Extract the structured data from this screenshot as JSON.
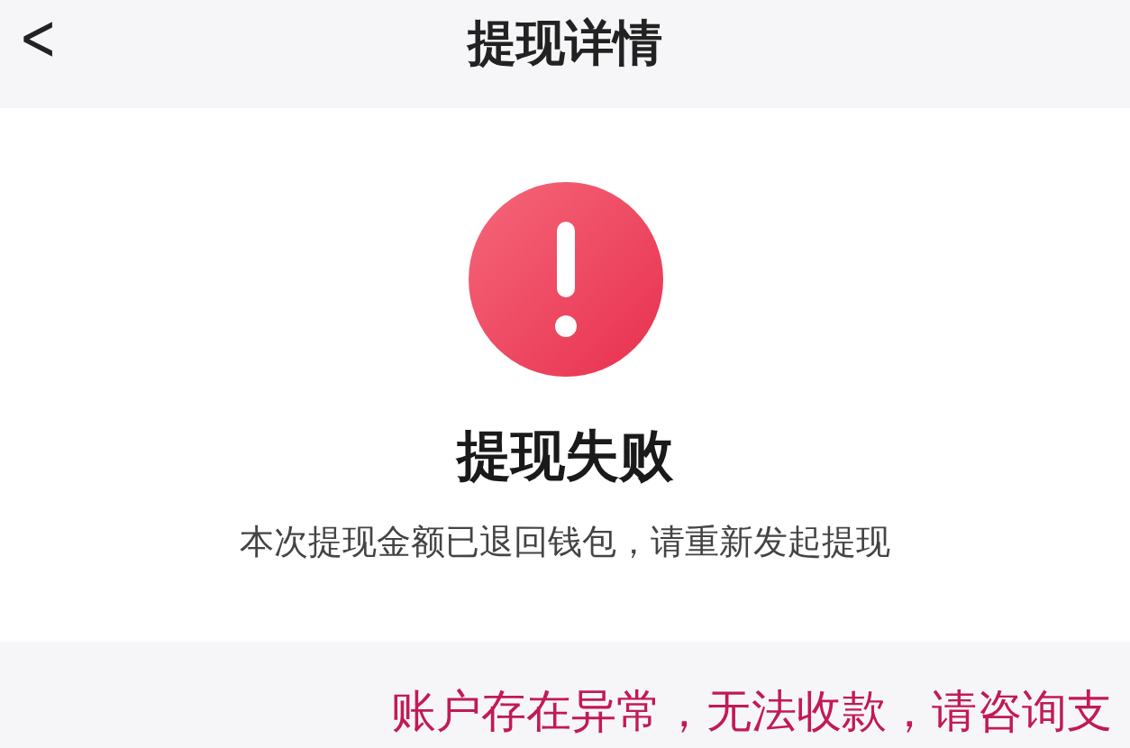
{
  "header": {
    "back": "<",
    "title": "提现详情"
  },
  "result": {
    "kind": "error",
    "title": "提现失败",
    "message": "本次提现金额已退回钱包，请重新发起提现"
  },
  "notice": {
    "text": "账户存在异常，无法收款，请咨询支"
  }
}
